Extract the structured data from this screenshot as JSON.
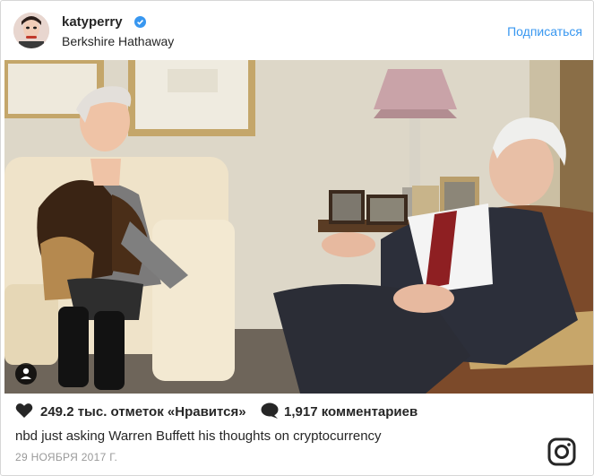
{
  "post": {
    "username": "katyperry",
    "location": "Berkshire Hathaway",
    "follow_label": "Подписаться",
    "likes_text": "249.2 тыс. отметок «Нравится»",
    "comments_text": "1,917 комментариев",
    "caption": "nbd just asking Warren Buffett his thoughts on cryptocurrency",
    "date": "29 НОЯБРЯ 2017 Г."
  },
  "colors": {
    "accent": "#3897f0",
    "text": "#262626",
    "muted": "#999999"
  },
  "icons": [
    "verified-badge-icon",
    "tag-people-icon",
    "heart-icon",
    "comment-icon",
    "instagram-logo-icon"
  ]
}
